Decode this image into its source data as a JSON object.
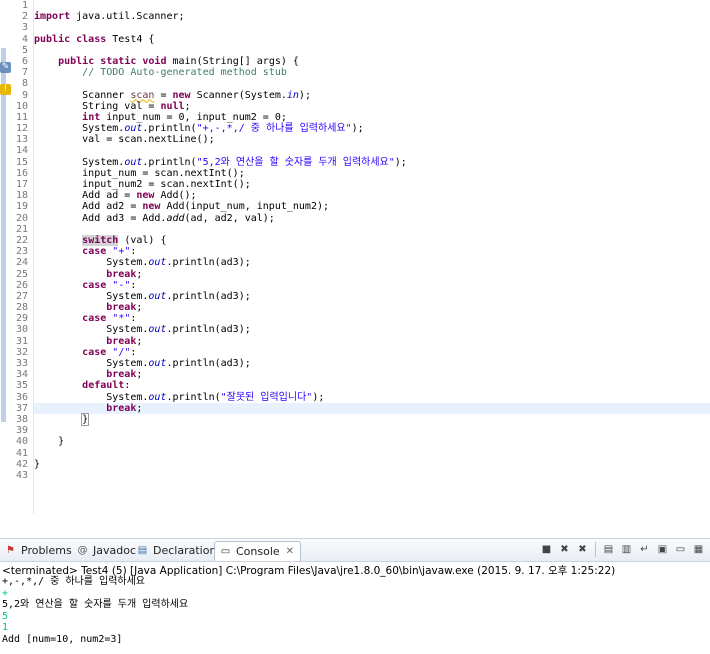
{
  "editor": {
    "line_numbers": [
      "1",
      "2",
      "3",
      "4",
      "5",
      "6",
      "7",
      "8",
      "9",
      "10",
      "11",
      "12",
      "13",
      "14",
      "15",
      "16",
      "17",
      "18",
      "19",
      "20",
      "21",
      "22",
      "23",
      "24",
      "25",
      "26",
      "27",
      "28",
      "29",
      "30",
      "31",
      "32",
      "33",
      "34",
      "35",
      "36",
      "37",
      "38",
      "39",
      "40",
      "41",
      "42",
      "43"
    ],
    "fold_marker": "⊖"
  },
  "console_view": {
    "tabs": [
      {
        "label": "Problems",
        "icon": "problems-icon"
      },
      {
        "label": "Javadoc",
        "icon": "at-icon"
      },
      {
        "label": "Declaration",
        "icon": "declaration-icon"
      },
      {
        "label": "Console",
        "icon": "console-icon"
      }
    ],
    "close_glyph": "✕",
    "status": "<terminated> Test4 (5) [Java Application] C:\\Program Files\\Java\\jre1.8.0_60\\bin\\javaw.exe (2015. 9. 17. 오후 1:25:22)",
    "output": [
      {
        "text": "+,-,*,/ 중 하나를 입력하세요",
        "kind": "out"
      },
      {
        "text": "+",
        "kind": "input"
      },
      {
        "text": "5,2와 연산을 할 숫자를 두개 입력하세요",
        "kind": "out"
      },
      {
        "text": "5",
        "kind": "input"
      },
      {
        "text": "1",
        "kind": "input"
      },
      {
        "text": "Add [num=10, num2=3]",
        "kind": "out"
      }
    ]
  }
}
